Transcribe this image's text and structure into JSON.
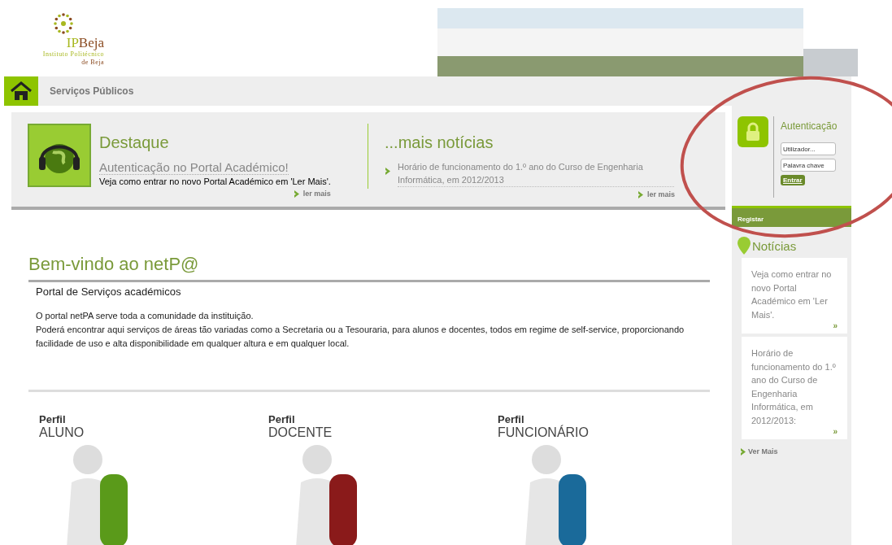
{
  "logo": {
    "name_part1": "IP",
    "name_part2": "Beja",
    "line1": "Instituto Politécnico",
    "line2": "de Beja"
  },
  "nav": {
    "items": [
      {
        "label": "Serviços Públicos"
      }
    ]
  },
  "highlight": {
    "title": "Destaque",
    "headline": "Autenticação no Portal Académico!",
    "text": "Veja como entrar no novo Portal Académico em 'Ler Mais'.",
    "more": "ler mais"
  },
  "more_news": {
    "title": "...mais notícias",
    "items": [
      {
        "text": "Horário de funcionamento do 1.º ano do Curso de Engenharia Informática, em 2012/2013"
      }
    ],
    "more": "ler mais"
  },
  "welcome": {
    "title": "Bem-vindo ao netP@",
    "subtitle": "Portal de Serviços académicos",
    "paragraphs": [
      "O portal netPA serve toda a comunidade da instituição.",
      "Poderá encontrar aqui serviços de áreas tão variadas como a Secretaria ou a Tesouraria, para alunos e docentes, todos em regime de self-service, proporcionando facilidade de uso e alta disponibilidade em qualquer altura e em qualquer local."
    ]
  },
  "profiles": [
    {
      "label": "Perfil",
      "name": "ALUNO",
      "color": "#5a9a1a"
    },
    {
      "label": "Perfil",
      "name": "DOCENTE",
      "color": "#8a1a1a"
    },
    {
      "label": "Perfil",
      "name": "FUNCIONÁRIO",
      "color": "#1a6a9a"
    }
  ],
  "auth": {
    "title": "Autenticação",
    "user_placeholder": "Utilizador...",
    "password_placeholder": "Palavra chave",
    "submit": "Entrar",
    "register": "Registar"
  },
  "sidebar_news": {
    "title": "Notícias",
    "items": [
      {
        "text": "Veja como entrar no novo Portal Académico em 'Ler Mais'.",
        "more": "»"
      },
      {
        "text": "Horário de funcionamento do 1.º ano do Curso de Engenharia Informática, em 2012/2013:",
        "more": "»"
      }
    ],
    "more": "Ver Mais"
  }
}
